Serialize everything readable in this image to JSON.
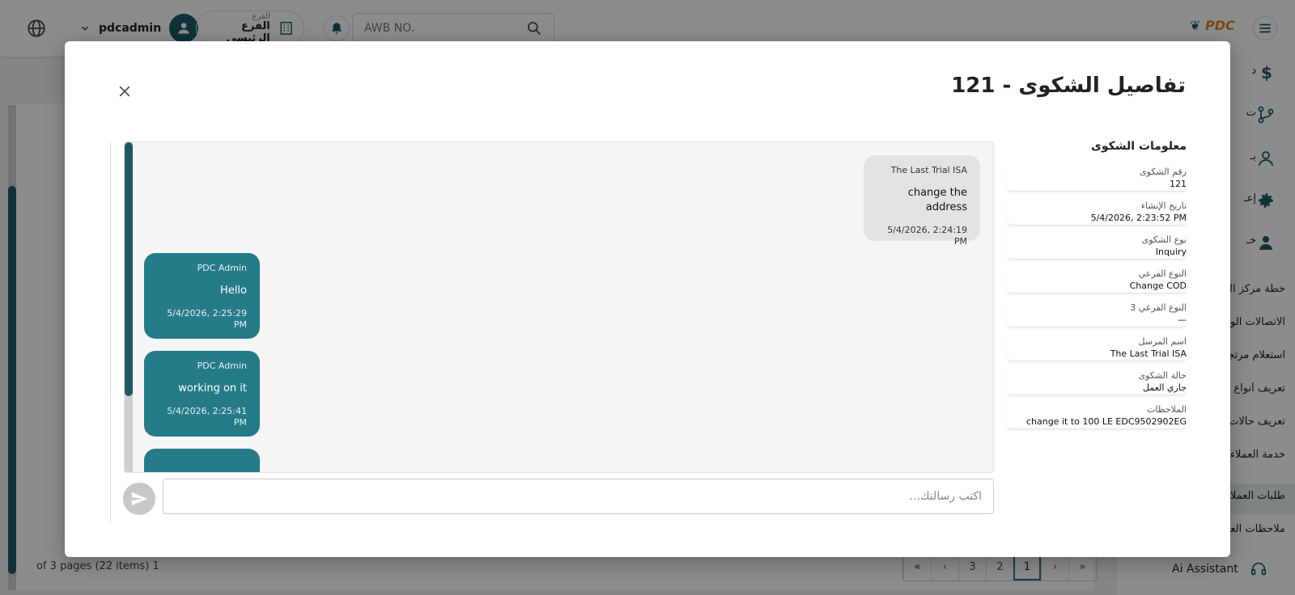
{
  "topbar": {
    "username": "pdcadmin",
    "branch_label": "الفرع",
    "branch_value": "الفرع الرئيسي",
    "search_placeholder": "AWB NO.",
    "logo_text": "PDC"
  },
  "sidebar": {
    "items": [
      {
        "label": "خطة مركز العمل"
      },
      {
        "label": "الاتصالات الواردة"
      },
      {
        "label": "استعلام مرتجع"
      },
      {
        "label": "تعريف أنواع"
      },
      {
        "label": "تعريف حالات"
      },
      {
        "label": "خدمة العملاء"
      },
      {
        "label": "طلبات العملاء"
      },
      {
        "label": "ملاحظات العملاء"
      }
    ],
    "partial_labels": [
      "د",
      "ت",
      "بـ",
      "إعـ",
      "خـ"
    ],
    "ai_assistant": "Ai Assistant"
  },
  "pager": {
    "info": "of 3 pages (22 items) 1",
    "first": "«",
    "prev": "‹",
    "next": "›",
    "last": "»",
    "pages": [
      "3",
      "2",
      "1"
    ]
  },
  "modal": {
    "title": "تفاصيل الشكوى - 121",
    "info_title": "معلومات الشكوى",
    "fields": [
      {
        "label": "رقم الشكوى",
        "value": "121"
      },
      {
        "label": "تاريخ الإنشاء",
        "value": "5/4/2026, 2:23:52 PM"
      },
      {
        "label": "نوع الشكوى",
        "value": "Inquiry"
      },
      {
        "label": "النوع الفرعي",
        "value": "Change COD"
      },
      {
        "label": "النوع الفرعي 3",
        "value": "—"
      },
      {
        "label": "اسم المرسل",
        "value": "The Last Trial ISA"
      },
      {
        "label": "حالة الشكوى",
        "value": "جاري العمل"
      },
      {
        "label": "الملاحظات",
        "value": "change it to 100 LE EDC9502902EG"
      }
    ],
    "messages": [
      {
        "sender": "The Last Trial ISA",
        "text": "change the address",
        "time": "5/4/2026, 2:24:19 PM",
        "direction": "in"
      },
      {
        "sender": "PDC Admin",
        "text": "Hello",
        "time": "5/4/2026, 2:25:29 PM",
        "direction": "out"
      },
      {
        "sender": "PDC Admin",
        "text": "working on it",
        "time": "5/4/2026, 2:25:41 PM",
        "direction": "out"
      }
    ],
    "input_placeholder": "اكتب رسالتك..."
  },
  "colors": {
    "brand_teal": "#1e5a64",
    "bubble_out": "#257b8a",
    "bubble_in": "#e3e3e3",
    "logo_orange": "#d4881c"
  }
}
